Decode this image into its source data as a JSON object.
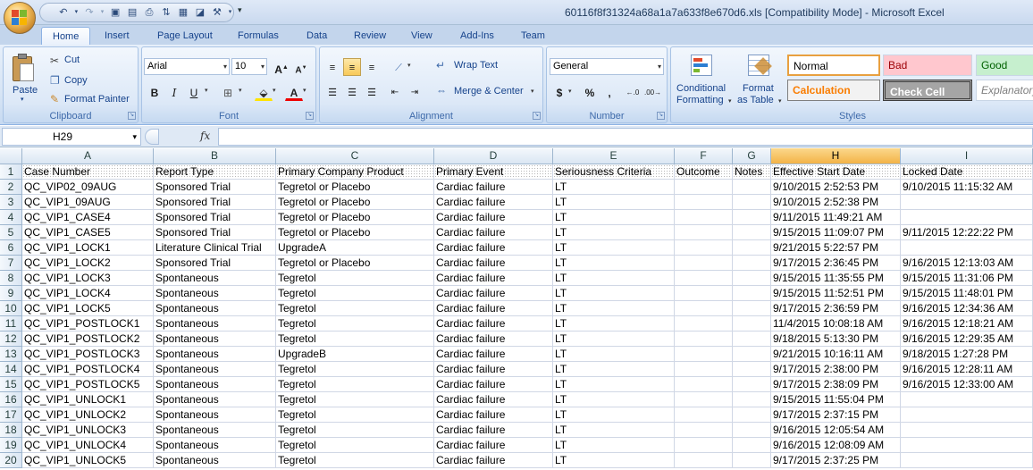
{
  "window": {
    "title": "60116f8f31324a68a1a7a633f8e670d6.xls  [Compatibility Mode] - Microsoft Excel"
  },
  "ribbon": {
    "tabs": [
      "Home",
      "Insert",
      "Page Layout",
      "Formulas",
      "Data",
      "Review",
      "View",
      "Add-Ins",
      "Team"
    ],
    "active_tab": "Home",
    "clipboard": {
      "paste": "Paste",
      "cut": "Cut",
      "copy": "Copy",
      "format_painter": "Format Painter",
      "label": "Clipboard"
    },
    "font": {
      "name": "Arial",
      "size": "10",
      "label": "Font"
    },
    "alignment": {
      "wrap_text": "Wrap Text",
      "merge_center": "Merge & Center",
      "label": "Alignment"
    },
    "number": {
      "format": "General",
      "label": "Number"
    },
    "styles": {
      "conditional_formatting_1": "Conditional",
      "conditional_formatting_2": "Formatting",
      "format_table_1": "Format",
      "format_table_2": "as Table",
      "normal": "Normal",
      "bad": "Bad",
      "good": "Good",
      "calculation": "Calculation",
      "check_cell": "Check Cell",
      "explanatory": "Explanatory ...",
      "label": "Styles"
    }
  },
  "formula_bar": {
    "name_box": "H29",
    "fx": "fx",
    "formula": ""
  },
  "sheet": {
    "selected_column": "H",
    "columns": [
      "A",
      "B",
      "C",
      "D",
      "E",
      "F",
      "G",
      "H",
      "I"
    ],
    "row_numbers": [
      "1",
      "2",
      "3",
      "4",
      "5",
      "6",
      "7",
      "8",
      "9",
      "10",
      "11",
      "12",
      "13",
      "14",
      "15",
      "16",
      "17",
      "18",
      "19",
      "20"
    ],
    "headers": [
      "Case Number",
      "Report Type",
      "Primary Company Product",
      "Primary Event",
      "Seriousness Criteria",
      "Outcome",
      "Notes",
      "Effective Start Date",
      "Locked Date"
    ],
    "rows": [
      [
        "QC_VIP02_09AUG",
        "Sponsored Trial",
        "Tegretol or Placebo",
        "Cardiac failure",
        "LT",
        "",
        "",
        "9/10/2015 2:52:53 PM",
        "9/10/2015 11:15:32 AM"
      ],
      [
        "QC_VIP1_09AUG",
        "Sponsored Trial",
        "Tegretol or Placebo",
        "Cardiac failure",
        "LT",
        "",
        "",
        "9/10/2015 2:52:38 PM",
        ""
      ],
      [
        "QC_VIP1_CASE4",
        "Sponsored Trial",
        "Tegretol or Placebo",
        "Cardiac failure",
        "LT",
        "",
        "",
        "9/11/2015 11:49:21 AM",
        ""
      ],
      [
        "QC_VIP1_CASE5",
        "Sponsored Trial",
        "Tegretol or Placebo",
        "Cardiac failure",
        "LT",
        "",
        "",
        "9/15/2015 11:09:07 PM",
        "9/11/2015 12:22:22 PM"
      ],
      [
        "QC_VIP1_LOCK1",
        "Literature Clinical Trial",
        "UpgradeA",
        "Cardiac failure",
        "LT",
        "",
        "",
        "9/21/2015 5:22:57 PM",
        ""
      ],
      [
        "QC_VIP1_LOCK2",
        "Sponsored Trial",
        "Tegretol or Placebo",
        "Cardiac failure",
        "LT",
        "",
        "",
        "9/17/2015 2:36:45 PM",
        "9/16/2015 12:13:03 AM"
      ],
      [
        "QC_VIP1_LOCK3",
        "Spontaneous",
        "Tegretol",
        "Cardiac failure",
        "LT",
        "",
        "",
        "9/15/2015 11:35:55 PM",
        "9/15/2015 11:31:06 PM"
      ],
      [
        "QC_VIP1_LOCK4",
        "Spontaneous",
        "Tegretol",
        "Cardiac failure",
        "LT",
        "",
        "",
        "9/15/2015 11:52:51 PM",
        "9/15/2015 11:48:01 PM"
      ],
      [
        "QC_VIP1_LOCK5",
        "Spontaneous",
        "Tegretol",
        "Cardiac failure",
        "LT",
        "",
        "",
        "9/17/2015 2:36:59 PM",
        "9/16/2015 12:34:36 AM"
      ],
      [
        "QC_VIP1_POSTLOCK1",
        "Spontaneous",
        "Tegretol",
        "Cardiac failure",
        "LT",
        "",
        "",
        "11/4/2015 10:08:18 AM",
        "9/16/2015 12:18:21 AM"
      ],
      [
        "QC_VIP1_POSTLOCK2",
        "Spontaneous",
        "Tegretol",
        "Cardiac failure",
        "LT",
        "",
        "",
        "9/18/2015 5:13:30 PM",
        "9/16/2015 12:29:35 AM"
      ],
      [
        "QC_VIP1_POSTLOCK3",
        "Spontaneous",
        "UpgradeB",
        "Cardiac failure",
        "LT",
        "",
        "",
        "9/21/2015 10:16:11 AM",
        "9/18/2015 1:27:28 PM"
      ],
      [
        "QC_VIP1_POSTLOCK4",
        "Spontaneous",
        "Tegretol",
        "Cardiac failure",
        "LT",
        "",
        "",
        "9/17/2015 2:38:00 PM",
        "9/16/2015 12:28:11 AM"
      ],
      [
        "QC_VIP1_POSTLOCK5",
        "Spontaneous",
        "Tegretol",
        "Cardiac failure",
        "LT",
        "",
        "",
        "9/17/2015 2:38:09 PM",
        "9/16/2015 12:33:00 AM"
      ],
      [
        "QC_VIP1_UNLOCK1",
        "Spontaneous",
        "Tegretol",
        "Cardiac failure",
        "LT",
        "",
        "",
        "9/15/2015 11:55:04 PM",
        ""
      ],
      [
        "QC_VIP1_UNLOCK2",
        "Spontaneous",
        "Tegretol",
        "Cardiac failure",
        "LT",
        "",
        "",
        "9/17/2015 2:37:15 PM",
        ""
      ],
      [
        "QC_VIP1_UNLOCK3",
        "Spontaneous",
        "Tegretol",
        "Cardiac failure",
        "LT",
        "",
        "",
        "9/16/2015 12:05:54 AM",
        ""
      ],
      [
        "QC_VIP1_UNLOCK4",
        "Spontaneous",
        "Tegretol",
        "Cardiac failure",
        "LT",
        "",
        "",
        "9/16/2015 12:08:09 AM",
        ""
      ],
      [
        "QC_VIP1_UNLOCK5",
        "Spontaneous",
        "Tegretol",
        "Cardiac failure",
        "LT",
        "",
        "",
        "9/17/2015 2:37:25 PM",
        ""
      ]
    ]
  }
}
